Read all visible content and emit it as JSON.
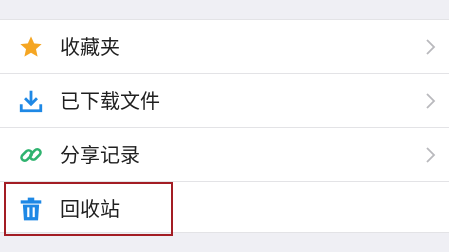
{
  "menu": {
    "items": [
      {
        "label": "收藏夹",
        "icon": "star-icon",
        "icon_color": "#f5a623"
      },
      {
        "label": "已下载文件",
        "icon": "download-icon",
        "icon_color": "#1e88e5"
      },
      {
        "label": "分享记录",
        "icon": "link-icon",
        "icon_color": "#2fb36f"
      },
      {
        "label": "回收站",
        "icon": "trash-icon",
        "icon_color": "#1e88e5"
      }
    ],
    "chevron_icon": "chevron-right-icon",
    "chevron_color": "#b9b9bd",
    "highlighted_item": "回收站",
    "highlight_color": "#a31d24"
  }
}
